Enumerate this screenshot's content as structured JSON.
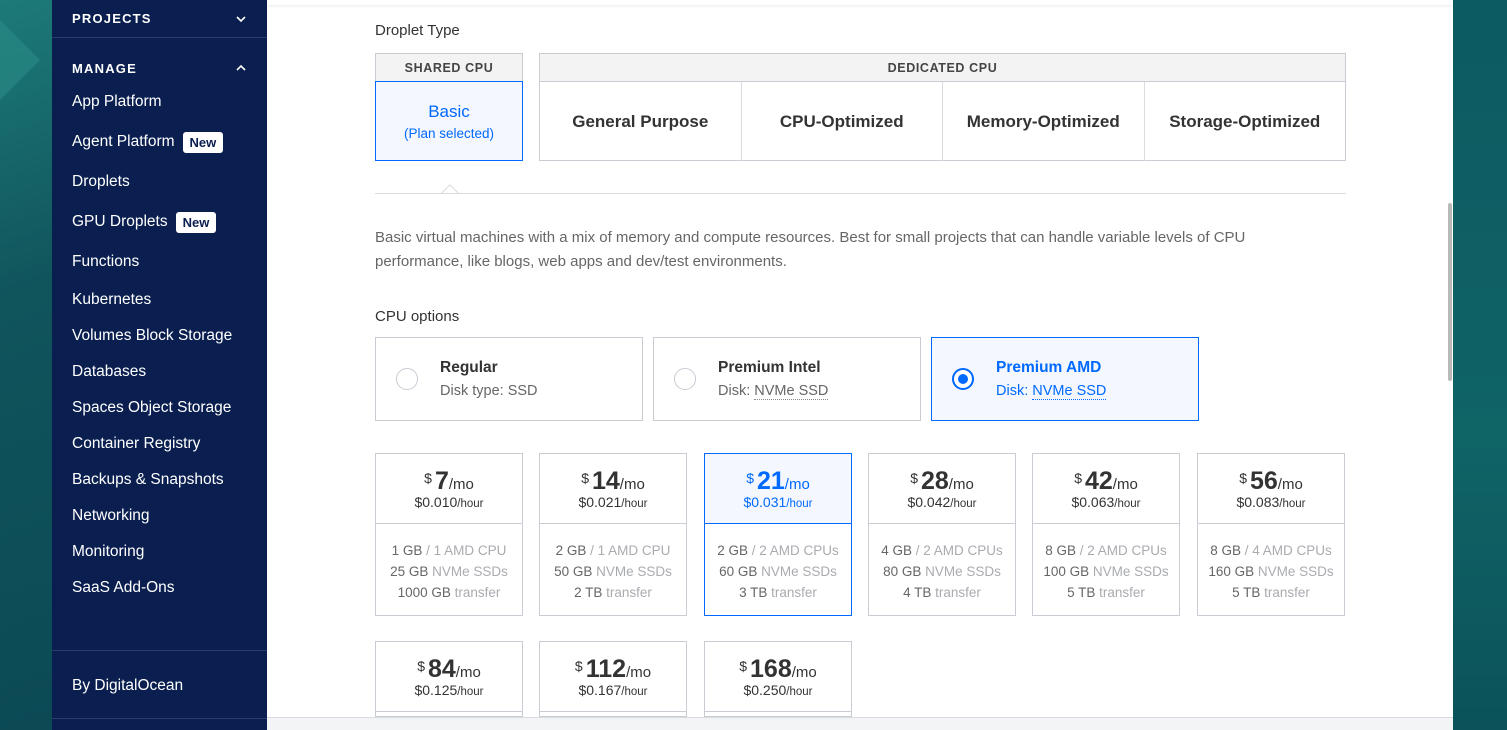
{
  "sidebar": {
    "projects_label": "PROJECTS",
    "manage_label": "MANAGE",
    "items": [
      {
        "label": "App Platform"
      },
      {
        "label": "Agent Platform",
        "badge": "New"
      },
      {
        "label": "Droplets"
      },
      {
        "label": "GPU Droplets",
        "badge": "New"
      },
      {
        "label": "Functions"
      },
      {
        "label": "Kubernetes"
      },
      {
        "label": "Volumes Block Storage"
      },
      {
        "label": "Databases"
      },
      {
        "label": "Spaces Object Storage"
      },
      {
        "label": "Container Registry"
      },
      {
        "label": "Backups & Snapshots"
      },
      {
        "label": "Networking"
      },
      {
        "label": "Monitoring"
      },
      {
        "label": "SaaS Add-Ons"
      }
    ],
    "footer": "By DigitalOcean"
  },
  "droplet_type": {
    "label": "Droplet Type",
    "shared_head": "SHARED CPU",
    "basic_title": "Basic",
    "basic_sub": "(Plan selected)",
    "dedicated_head": "DEDICATED CPU",
    "dedicated_tiles": [
      "General Purpose",
      "CPU-Optimized",
      "Memory-Optimized",
      "Storage-Optimized"
    ]
  },
  "description": "Basic virtual machines with a mix of memory and compute resources. Best for small projects that can handle variable levels of CPU performance, like blogs, web apps and dev/test environments.",
  "cpu_options": {
    "label": "CPU options",
    "options": [
      {
        "title": "Regular",
        "sub_prefix": "Disk type: ",
        "sub_value": "SSD",
        "selected": false
      },
      {
        "title": "Premium Intel",
        "sub_prefix": "Disk: ",
        "sub_value": "NVMe SSD",
        "selected": false
      },
      {
        "title": "Premium AMD",
        "sub_prefix": "Disk: ",
        "sub_value": "NVMe SSD",
        "selected": true
      }
    ]
  },
  "plans": [
    {
      "dollar": "$",
      "amount": "7",
      "per": "/mo",
      "hourly": "$0.010",
      "hour_suffix": "/hour",
      "mem": "1 GB",
      "cpu": "/ 1 AMD CPU",
      "disk": "25 GB",
      "disk_type": "NVMe SSDs",
      "transfer": "1000 GB",
      "transfer_label": "transfer",
      "selected": false
    },
    {
      "dollar": "$",
      "amount": "14",
      "per": "/mo",
      "hourly": "$0.021",
      "hour_suffix": "/hour",
      "mem": "2 GB",
      "cpu": "/ 1 AMD CPU",
      "disk": "50 GB",
      "disk_type": "NVMe SSDs",
      "transfer": "2 TB",
      "transfer_label": "transfer",
      "selected": false
    },
    {
      "dollar": "$",
      "amount": "21",
      "per": "/mo",
      "hourly": "$0.031",
      "hour_suffix": "/hour",
      "mem": "2 GB",
      "cpu": "/ 2 AMD CPUs",
      "disk": "60 GB",
      "disk_type": "NVMe SSDs",
      "transfer": "3 TB",
      "transfer_label": "transfer",
      "selected": true
    },
    {
      "dollar": "$",
      "amount": "28",
      "per": "/mo",
      "hourly": "$0.042",
      "hour_suffix": "/hour",
      "mem": "4 GB",
      "cpu": "/ 2 AMD CPUs",
      "disk": "80 GB",
      "disk_type": "NVMe SSDs",
      "transfer": "4 TB",
      "transfer_label": "transfer",
      "selected": false
    },
    {
      "dollar": "$",
      "amount": "42",
      "per": "/mo",
      "hourly": "$0.063",
      "hour_suffix": "/hour",
      "mem": "8 GB",
      "cpu": "/ 2 AMD CPUs",
      "disk": "100 GB",
      "disk_type": "NVMe SSDs",
      "transfer": "5 TB",
      "transfer_label": "transfer",
      "selected": false
    },
    {
      "dollar": "$",
      "amount": "56",
      "per": "/mo",
      "hourly": "$0.083",
      "hour_suffix": "/hour",
      "mem": "8 GB",
      "cpu": "/ 4 AMD CPUs",
      "disk": "160 GB",
      "disk_type": "NVMe SSDs",
      "transfer": "5 TB",
      "transfer_label": "transfer",
      "selected": false
    },
    {
      "dollar": "$",
      "amount": "84",
      "per": "/mo",
      "hourly": "$0.125",
      "hour_suffix": "/hour",
      "selected": false
    },
    {
      "dollar": "$",
      "amount": "112",
      "per": "/mo",
      "hourly": "$0.167",
      "hour_suffix": "/hour",
      "selected": false
    },
    {
      "dollar": "$",
      "amount": "168",
      "per": "/mo",
      "hourly": "$0.250",
      "hour_suffix": "/hour",
      "selected": false
    }
  ],
  "colors": {
    "sidebar_bg": "#0a1f4f",
    "accent": "#0069ff"
  }
}
